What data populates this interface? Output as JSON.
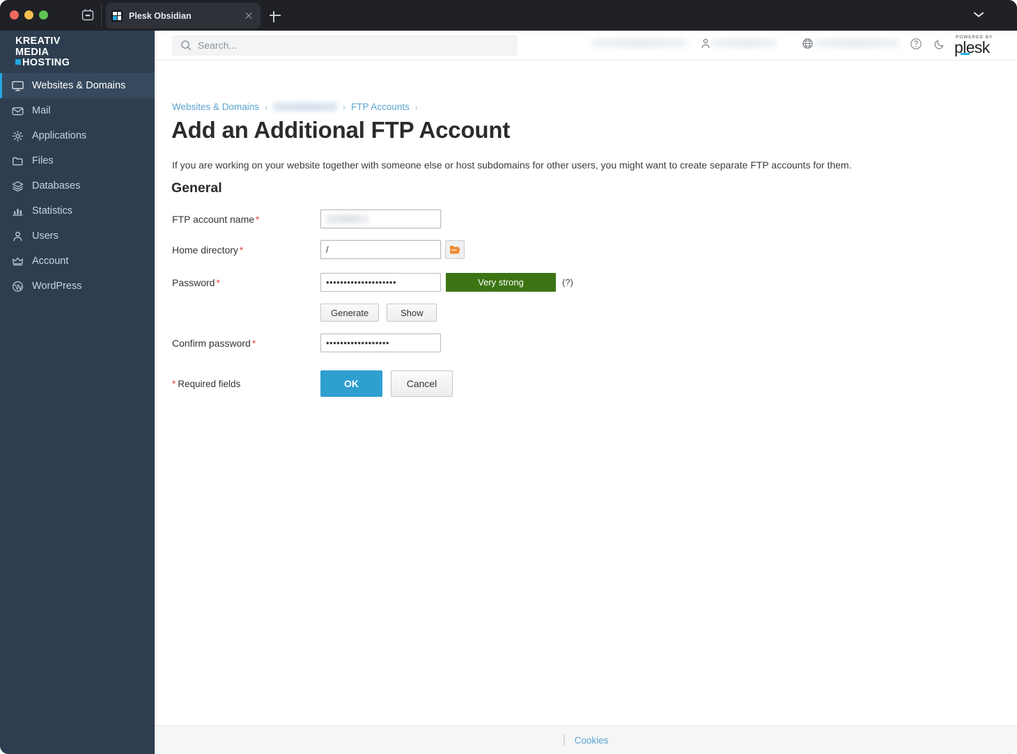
{
  "browser": {
    "tab_title": "Plesk Obsidian",
    "favicon_name": "kmh-favicon",
    "new_tab_label": "+",
    "close_tab_label": "×"
  },
  "sidebar": {
    "brand": {
      "line1": "KREATIV",
      "line2": "MEDIA",
      "line3": "HOSTING"
    },
    "items": [
      {
        "label": "Websites & Domains",
        "icon": "monitor-icon",
        "active": true
      },
      {
        "label": "Mail",
        "icon": "envelope-icon",
        "active": false
      },
      {
        "label": "Applications",
        "icon": "gear-icon",
        "active": false
      },
      {
        "label": "Files",
        "icon": "folder-icon",
        "active": false
      },
      {
        "label": "Databases",
        "icon": "database-stack-icon",
        "active": false
      },
      {
        "label": "Statistics",
        "icon": "bar-chart-icon",
        "active": false
      },
      {
        "label": "Users",
        "icon": "person-icon",
        "active": false
      },
      {
        "label": "Account",
        "icon": "crown-icon",
        "active": false
      },
      {
        "label": "WordPress",
        "icon": "wordpress-icon",
        "active": false
      }
    ],
    "collapse_handle_icon": "chevron-left-icon"
  },
  "topbar": {
    "search_placeholder": "Search...",
    "search_value": "",
    "search_icon": "search-icon",
    "server_name_redacted": "",
    "user_name_redacted": "",
    "domain_name_redacted": "",
    "user_icon": "person-icon",
    "globe_icon": "globe-icon",
    "help_icon": "question-circle-icon",
    "darkmode_icon": "moon-icon",
    "plesk_powered_by": "POWERED BY",
    "plesk_wordmark": "plesk"
  },
  "breadcrumb": {
    "items": [
      {
        "label": "Websites & Domains",
        "redacted": false
      },
      {
        "label": "",
        "redacted": true
      },
      {
        "label": "FTP Accounts",
        "redacted": false
      }
    ],
    "separator": "›"
  },
  "main": {
    "title": "Add an Additional FTP Account",
    "description": "If you are working on your website together with someone else or host subdomains for other users, you might want to create separate FTP accounts for them.",
    "section_general": "General",
    "fields": {
      "ftp_account_name": {
        "label": "FTP account name",
        "required_marker": "*",
        "value": "",
        "redacted": true
      },
      "home_directory": {
        "label": "Home directory",
        "required_marker": "*",
        "value": "/",
        "browse_icon": "folder-open-icon"
      },
      "password": {
        "label": "Password",
        "required_marker": "*",
        "value": "••••••••••••••••••••",
        "strength_label": "Very strong",
        "strength_color": "#3c7413",
        "hint_label": "(?)",
        "generate_label": "Generate",
        "show_label": "Show"
      },
      "confirm_password": {
        "label": "Confirm password",
        "required_marker": "*",
        "value": "••••••••••••••••••"
      }
    },
    "required_fields_note": "Required fields",
    "required_fields_marker": "*",
    "ok_label": "OK",
    "cancel_label": "Cancel"
  },
  "footer": {
    "cookies_label": "Cookies"
  },
  "colors": {
    "sidebar_bg": "#2e3e50",
    "sidebar_active_bg": "#37495d",
    "accent_blue": "#23a8e0",
    "primary_button": "#2f9fd0",
    "link_blue": "#5ba4cf",
    "required_red": "#e0414b",
    "strength_green": "#3c7413",
    "folder_orange": "#f2892e"
  }
}
